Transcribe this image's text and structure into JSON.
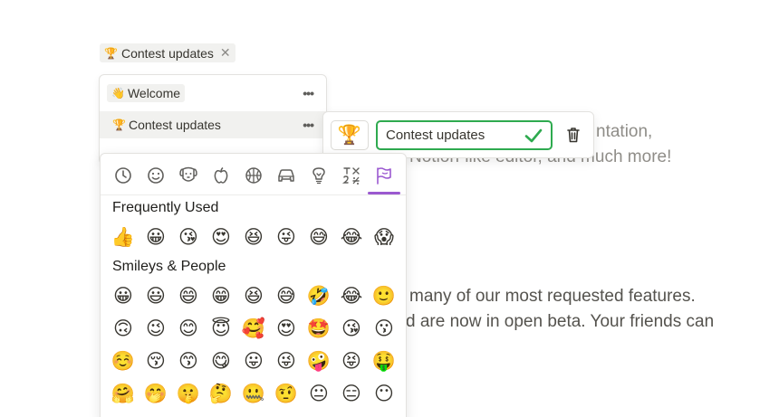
{
  "top_chip": {
    "emoji": "🏆",
    "label": "Contest updates",
    "close": "✕"
  },
  "menu": {
    "items": [
      {
        "emoji": "👋",
        "label": "Welcome",
        "more": "•••"
      },
      {
        "emoji": "🏆",
        "label": "Contest updates",
        "more": "•••"
      }
    ]
  },
  "document": {
    "line1": "ntation,",
    "line2": "Notion-like editor, and much more!",
    "line3": "many of our most requested features.",
    "line4": "d are now in open beta. Your friends can"
  },
  "rename": {
    "emoji": "🏆",
    "value": "Contest updates",
    "accent": "#2eaa4f"
  },
  "picker": {
    "categories": [
      "clock-icon",
      "smiley-icon",
      "dog-icon",
      "apple-icon",
      "basketball-icon",
      "car-icon",
      "lightbulb-icon",
      "symbols-icon",
      "flag-icon"
    ],
    "active_category": "flag-icon",
    "accent": "#9b59d0",
    "frequently_used_title": "Frequently Used",
    "frequently_used": [
      "👍",
      "😀",
      "😘",
      "😍",
      "😆",
      "😜",
      "😅",
      "😂",
      "😱"
    ],
    "smileys_title": "Smileys & People",
    "smileys": [
      [
        "😀",
        "😃",
        "😄",
        "😁",
        "😆",
        "😅",
        "🤣",
        "😂",
        "🙂"
      ],
      [
        "🙃",
        "😉",
        "😊",
        "😇",
        "🥰",
        "😍",
        "🤩",
        "😘",
        "😗"
      ],
      [
        "☺️",
        "😚",
        "😙",
        "😋",
        "😛",
        "😜",
        "🤪",
        "😝",
        "🤑"
      ],
      [
        "🤗",
        "🤭",
        "🤫",
        "🤔",
        "🤐",
        "🤨",
        "😐",
        "😑",
        "😶"
      ]
    ]
  }
}
